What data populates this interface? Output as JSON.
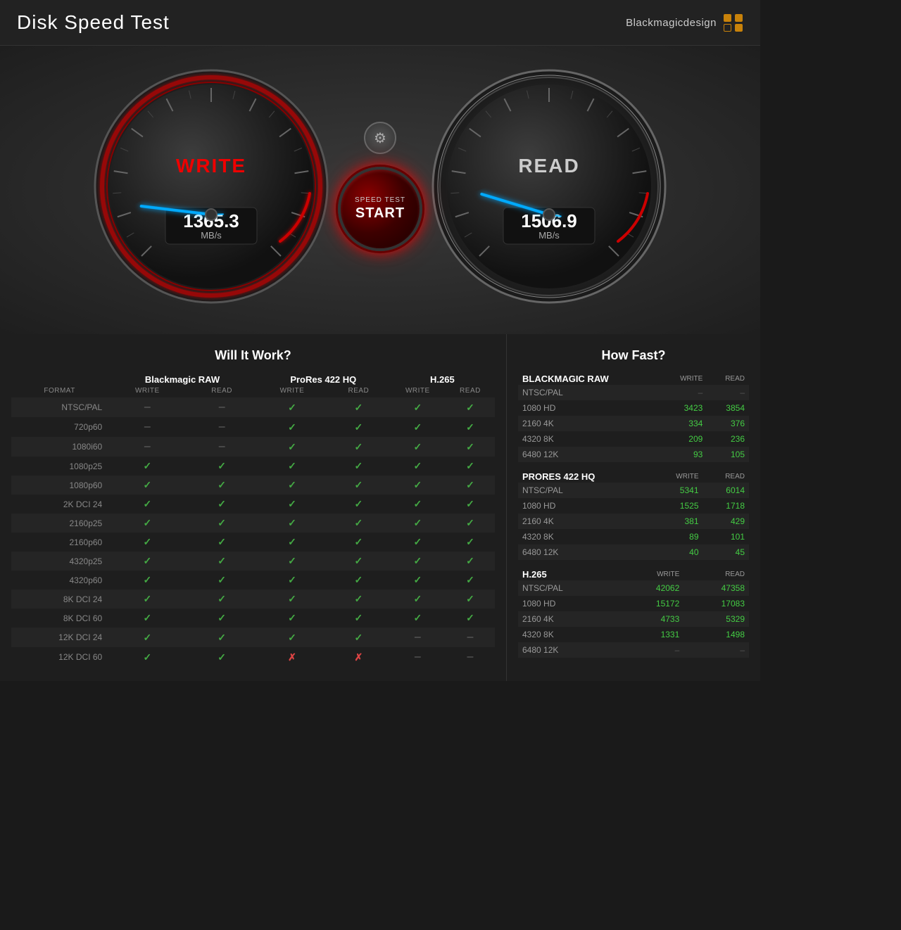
{
  "header": {
    "title": "Disk Speed Test",
    "logo_text": "Blackmagicdesign"
  },
  "gauges": {
    "write": {
      "label": "WRITE",
      "value": "1365.3",
      "unit": "MB/s"
    },
    "read": {
      "label": "READ",
      "value": "1506.9",
      "unit": "MB/s"
    }
  },
  "start_button": {
    "line1": "SPEED TEST",
    "line2": "START"
  },
  "will_it_work": {
    "title": "Will It Work?",
    "column_groups": [
      {
        "label": "Blackmagic RAW",
        "cols": [
          "WRITE",
          "READ"
        ]
      },
      {
        "label": "ProRes 422 HQ",
        "cols": [
          "WRITE",
          "READ"
        ]
      },
      {
        "label": "H.265",
        "cols": [
          "WRITE",
          "READ"
        ]
      }
    ],
    "format_header": "FORMAT",
    "rows": [
      {
        "format": "NTSC/PAL",
        "vals": [
          "–",
          "–",
          "✓",
          "✓",
          "✓",
          "✓"
        ]
      },
      {
        "format": "720p60",
        "vals": [
          "–",
          "–",
          "✓",
          "✓",
          "✓",
          "✓"
        ]
      },
      {
        "format": "1080i60",
        "vals": [
          "–",
          "–",
          "✓",
          "✓",
          "✓",
          "✓"
        ]
      },
      {
        "format": "1080p25",
        "vals": [
          "✓",
          "✓",
          "✓",
          "✓",
          "✓",
          "✓"
        ]
      },
      {
        "format": "1080p60",
        "vals": [
          "✓",
          "✓",
          "✓",
          "✓",
          "✓",
          "✓"
        ]
      },
      {
        "format": "2K DCI 24",
        "vals": [
          "✓",
          "✓",
          "✓",
          "✓",
          "✓",
          "✓"
        ]
      },
      {
        "format": "2160p25",
        "vals": [
          "✓",
          "✓",
          "✓",
          "✓",
          "✓",
          "✓"
        ]
      },
      {
        "format": "2160p60",
        "vals": [
          "✓",
          "✓",
          "✓",
          "✓",
          "✓",
          "✓"
        ]
      },
      {
        "format": "4320p25",
        "vals": [
          "✓",
          "✓",
          "✓",
          "✓",
          "✓",
          "✓"
        ]
      },
      {
        "format": "4320p60",
        "vals": [
          "✓",
          "✓",
          "✓",
          "✓",
          "✓",
          "✓"
        ]
      },
      {
        "format": "8K DCI 24",
        "vals": [
          "✓",
          "✓",
          "✓",
          "✓",
          "✓",
          "✓"
        ]
      },
      {
        "format": "8K DCI 60",
        "vals": [
          "✓",
          "✓",
          "✓",
          "✓",
          "✓",
          "✓"
        ]
      },
      {
        "format": "12K DCI 24",
        "vals": [
          "✓",
          "✓",
          "✓",
          "✓",
          "–",
          "–"
        ]
      },
      {
        "format": "12K DCI 60",
        "vals": [
          "✓",
          "✓",
          "✗",
          "✗",
          "–",
          "–"
        ]
      }
    ]
  },
  "how_fast": {
    "title": "How Fast?",
    "sections": [
      {
        "codec": "Blackmagic RAW",
        "rows": [
          {
            "res": "NTSC/PAL",
            "write": "-",
            "read": "-"
          },
          {
            "res": "1080 HD",
            "write": "3423",
            "read": "3854"
          },
          {
            "res": "2160 4K",
            "write": "334",
            "read": "376"
          },
          {
            "res": "4320 8K",
            "write": "209",
            "read": "236"
          },
          {
            "res": "6480 12K",
            "write": "93",
            "read": "105"
          }
        ]
      },
      {
        "codec": "ProRes 422 HQ",
        "rows": [
          {
            "res": "NTSC/PAL",
            "write": "5341",
            "read": "6014"
          },
          {
            "res": "1080 HD",
            "write": "1525",
            "read": "1718"
          },
          {
            "res": "2160 4K",
            "write": "381",
            "read": "429"
          },
          {
            "res": "4320 8K",
            "write": "89",
            "read": "101"
          },
          {
            "res": "6480 12K",
            "write": "40",
            "read": "45"
          }
        ]
      },
      {
        "codec": "H.265",
        "rows": [
          {
            "res": "NTSC/PAL",
            "write": "42062",
            "read": "47358"
          },
          {
            "res": "1080 HD",
            "write": "15172",
            "read": "17083"
          },
          {
            "res": "2160 4K",
            "write": "4733",
            "read": "5329"
          },
          {
            "res": "4320 8K",
            "write": "1331",
            "read": "1498"
          },
          {
            "res": "6480 12K",
            "write": "-",
            "read": "-"
          }
        ]
      }
    ]
  }
}
